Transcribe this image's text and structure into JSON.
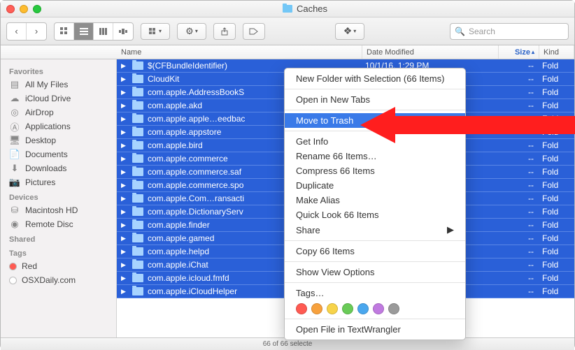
{
  "window": {
    "title": "Caches"
  },
  "search": {
    "placeholder": "Search"
  },
  "columns": {
    "name": "Name",
    "date": "Date Modified",
    "size": "Size",
    "kind": "Kind"
  },
  "sidebar": {
    "favorites_hdr": "Favorites",
    "devices_hdr": "Devices",
    "shared_hdr": "Shared",
    "tags_hdr": "Tags",
    "favorites": [
      {
        "label": "All My Files",
        "icon": "all-files-icon"
      },
      {
        "label": "iCloud Drive",
        "icon": "cloud-icon"
      },
      {
        "label": "AirDrop",
        "icon": "airdrop-icon"
      },
      {
        "label": "Applications",
        "icon": "apps-icon"
      },
      {
        "label": "Desktop",
        "icon": "desktop-icon"
      },
      {
        "label": "Documents",
        "icon": "documents-icon"
      },
      {
        "label": "Downloads",
        "icon": "downloads-icon"
      },
      {
        "label": "Pictures",
        "icon": "pictures-icon"
      }
    ],
    "devices": [
      {
        "label": "Macintosh HD",
        "icon": "disk-icon"
      },
      {
        "label": "Remote Disc",
        "icon": "remote-disc-icon"
      }
    ],
    "tags": [
      {
        "label": "Red",
        "color": "#ff5a52"
      },
      {
        "label": "OSXDaily.com",
        "color": "#ffffff"
      }
    ]
  },
  "files": [
    {
      "name": "$(CFBundleIdentifier)",
      "date": "10/1/16, 1:29 PM",
      "size": "--",
      "kind": "Fold"
    },
    {
      "name": "CloudKit",
      "date": "",
      "size": "--",
      "kind": "Fold"
    },
    {
      "name": "com.apple.AddressBookS",
      "date": "",
      "size": "--",
      "kind": "Fold"
    },
    {
      "name": "com.apple.akd",
      "date": "",
      "size": "--",
      "kind": "Fold"
    },
    {
      "name": "com.apple.apple…eedbac",
      "date": "",
      "size": "--",
      "kind": "Fold"
    },
    {
      "name": "com.apple.appstore",
      "date": "",
      "size": "--",
      "kind": "Fold"
    },
    {
      "name": "com.apple.bird",
      "date": "",
      "size": "--",
      "kind": "Fold"
    },
    {
      "name": "com.apple.commerce",
      "date": "",
      "size": "--",
      "kind": "Fold"
    },
    {
      "name": "com.apple.commerce.saf",
      "date": "",
      "size": "--",
      "kind": "Fold"
    },
    {
      "name": "com.apple.commerce.spo",
      "date": "",
      "size": "--",
      "kind": "Fold"
    },
    {
      "name": "com.apple.Com…ransacti",
      "date": "",
      "size": "--",
      "kind": "Fold"
    },
    {
      "name": "com.apple.DictionaryServ",
      "date": "",
      "size": "--",
      "kind": "Fold"
    },
    {
      "name": "com.apple.finder",
      "date": "",
      "size": "--",
      "kind": "Fold"
    },
    {
      "name": "com.apple.gamed",
      "date": "",
      "size": "--",
      "kind": "Fold"
    },
    {
      "name": "com.apple.helpd",
      "date": "",
      "size": "--",
      "kind": "Fold"
    },
    {
      "name": "com.apple.iChat",
      "date": "",
      "size": "--",
      "kind": "Fold"
    },
    {
      "name": "com.apple.icloud.fmfd",
      "date": "",
      "size": "--",
      "kind": "Fold"
    },
    {
      "name": "com.apple.iCloudHelper",
      "date": "",
      "size": "--",
      "kind": "Fold"
    }
  ],
  "status": "66 of 66 selecte",
  "ctx": {
    "new_folder": "New Folder with Selection (66 Items)",
    "open_tabs": "Open in New Tabs",
    "move_trash": "Move to Trash",
    "get_info": "Get Info",
    "rename": "Rename 66 Items…",
    "compress": "Compress 66 Items",
    "duplicate": "Duplicate",
    "alias": "Make Alias",
    "quicklook": "Quick Look 66 Items",
    "share": "Share",
    "copy": "Copy 66 Items",
    "viewopts": "Show View Options",
    "tags": "Tags…",
    "open_tw": "Open File in TextWrangler",
    "tag_colors": [
      "#ff5a52",
      "#f7a13d",
      "#f7d34a",
      "#69cb57",
      "#4aa7ee",
      "#c07ae0",
      "#9a9a9a"
    ]
  }
}
